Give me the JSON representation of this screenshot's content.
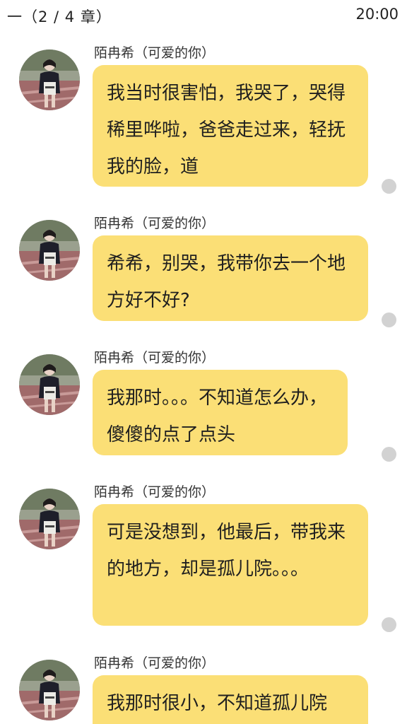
{
  "status": {
    "chapter": "一（2 / 4 章）",
    "time": "20:00"
  },
  "messages": [
    {
      "sender": "陌冉希（可爱的你）",
      "text": "我当时很害怕，我哭了，哭得稀里哗啦，爸爸走过来，轻抚我的脸，道"
    },
    {
      "sender": "陌冉希（可爱的你）",
      "text": "希希，别哭，我带你去一个地方好不好?"
    },
    {
      "sender": "陌冉希（可爱的你）",
      "text": "我那时。。。不知道怎么办，傻傻的点了点头"
    },
    {
      "sender": "陌冉希（可爱的你）",
      "text": "可是没想到，他最后，带我来的地方，却是孤儿院。。。"
    },
    {
      "sender": "陌冉希（可爱的你）",
      "text": "我那时很小，不知道孤儿院"
    }
  ],
  "colors": {
    "bubble": "#fbdf76",
    "read_dot": "#d2d2d2"
  }
}
